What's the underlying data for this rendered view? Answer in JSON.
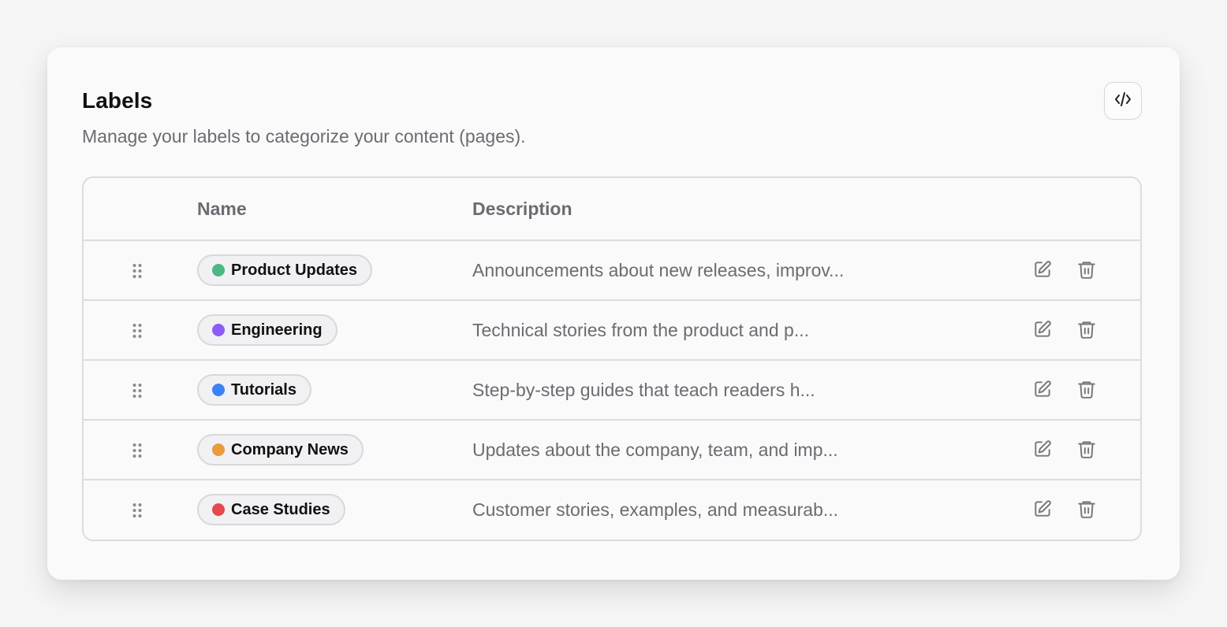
{
  "header": {
    "title": "Labels",
    "subtitle": "Manage your labels to categorize your content (pages).",
    "code_button_icon": "code-icon"
  },
  "table": {
    "columns": [
      "Name",
      "Description"
    ],
    "rows": [
      {
        "name": "Product Updates",
        "color": "#4cb782",
        "description": "Announcements about new releases, improv..."
      },
      {
        "name": "Engineering",
        "color": "#8b5cf6",
        "description": "Technical stories from the product and p..."
      },
      {
        "name": "Tutorials",
        "color": "#3b82f6",
        "description": "Step-by-step guides that teach readers h..."
      },
      {
        "name": "Company News",
        "color": "#eb9b3a",
        "description": "Updates about the company, team, and imp..."
      },
      {
        "name": "Case Studies",
        "color": "#e5484d",
        "description": "Customer stories, examples, and measurab..."
      }
    ],
    "row_icons": {
      "drag": "drag-handle-icon",
      "edit": "edit-icon",
      "delete": "trash-icon"
    }
  }
}
